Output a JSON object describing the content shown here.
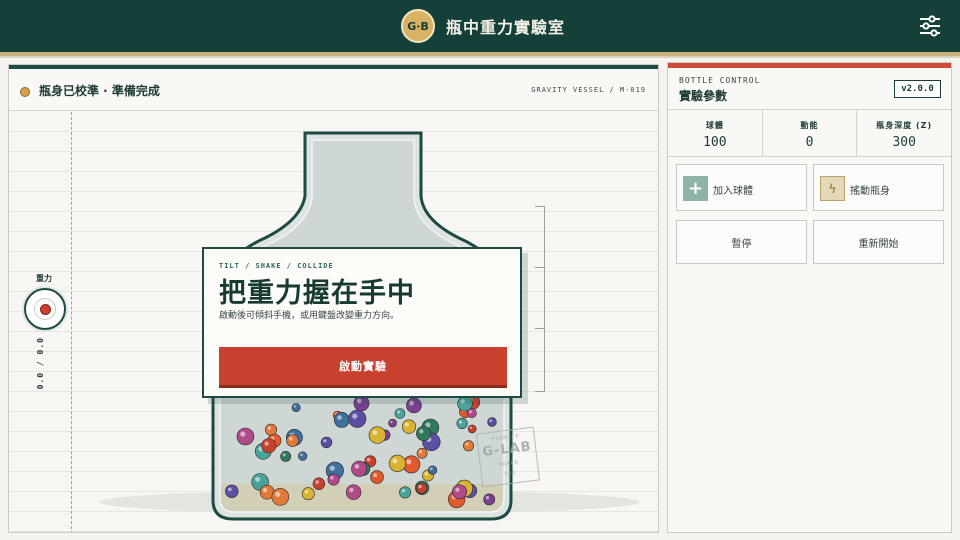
{
  "header": {
    "logo_text": "G·B",
    "title": "瓶中重力實驗室",
    "settings_icon": "sliders-icon"
  },
  "stage": {
    "status_text": "瓶身已校準 · 準備完成",
    "vessel_code": "GRAVITY VESSEL / M-019",
    "gravity_label": "重力",
    "gravity_readout": "0.0 / 0.0",
    "stamp_top": "FURMOFF",
    "stamp_main": "G-LAB",
    "stamp_sub": "MAKER",
    "stamp_sub2": "300"
  },
  "intro": {
    "kicker": "TILT / SHAKE / COLLIDE",
    "title": "把重力握在手中",
    "description": "啟動後可傾斜手機，或用鍵盤改變重力方向。",
    "start_label": "啟動實驗"
  },
  "panel": {
    "kicker": "BOTTLE CONTROL",
    "title": "實驗參數",
    "version": "v2.0.0",
    "stats": [
      {
        "label": "球體",
        "value": "100"
      },
      {
        "label": "動能",
        "value": "0"
      },
      {
        "label": "瓶身深度 (Z)",
        "value": "300"
      }
    ],
    "add_balls_label": "加入球體",
    "shake_label": "搖動瓶身",
    "pause_label": "暫停",
    "restart_label": "重新開始"
  },
  "colors": {
    "header_bg": "#153f39",
    "accent_red": "#c8412f",
    "accent_gold": "#d8b365",
    "ball_palette": [
      "#c8412f",
      "#e07a3a",
      "#d8b331",
      "#2f7a5f",
      "#3f6f9f",
      "#7a3f8f",
      "#b04a8a",
      "#4aa39a",
      "#e05a2e",
      "#5a4fa3"
    ]
  }
}
